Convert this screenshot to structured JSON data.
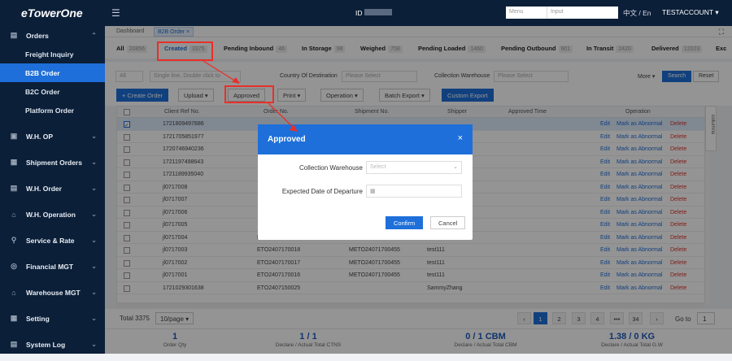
{
  "app": {
    "logo": "eTowerOne"
  },
  "topbar": {
    "id_label": "ID",
    "menu_select": "Menu",
    "menu_input": "Input",
    "lang": "中文 / En",
    "account": "TESTACCOUNT ▾"
  },
  "sidebar": {
    "items": [
      {
        "label": "Orders",
        "icon": "orders-icon",
        "glyph": "▤",
        "expanded": true,
        "children": [
          "Freight Inquiry",
          "B2B Order",
          "B2C Order",
          "Platform Order"
        ],
        "active_child": "B2B Order"
      },
      {
        "label": "W.H. OP",
        "icon": "warehouse-op-icon",
        "glyph": "▣"
      },
      {
        "label": "Shipment Orders",
        "icon": "shipment-icon",
        "glyph": "▦"
      },
      {
        "label": "W.H. Order",
        "icon": "wh-order-icon",
        "glyph": "▤"
      },
      {
        "label": "W.H. Operation",
        "icon": "wh-operation-icon",
        "glyph": "⌂"
      },
      {
        "label": "Service & Rate",
        "icon": "service-icon",
        "glyph": "⚲"
      },
      {
        "label": "Financial MGT",
        "icon": "financial-icon",
        "glyph": "◎"
      },
      {
        "label": "Warehouse MGT",
        "icon": "warehouse-mgt-icon",
        "glyph": "⌂"
      },
      {
        "label": "Setting",
        "icon": "setting-icon",
        "glyph": "▦"
      },
      {
        "label": "System Log",
        "icon": "log-icon",
        "glyph": "▤"
      }
    ]
  },
  "breadcrumb": {
    "home": "Dashboard",
    "tab": "B2B Order ×"
  },
  "status_tabs": [
    {
      "label": "All",
      "count": "20856"
    },
    {
      "label": "Created",
      "count": "3375",
      "active": true
    },
    {
      "label": "Pending Inbound",
      "count": "46"
    },
    {
      "label": "In Storage",
      "count": "98"
    },
    {
      "label": "Weighed",
      "count": "758"
    },
    {
      "label": "Pending Loaded",
      "count": "1460"
    },
    {
      "label": "Pending Outbound",
      "count": "901"
    },
    {
      "label": "In Transit",
      "count": "2420"
    },
    {
      "label": "Delivered",
      "count": "12023"
    },
    {
      "label": "Exc",
      "count": ""
    }
  ],
  "filter": {
    "all": "All",
    "search_placeholder": "Single line, Double click to",
    "dest_label": "Country Of Destination",
    "please_select": "Please Select",
    "collection_label": "Collection Warehouse",
    "more": "More ▾",
    "search_btn": "Search",
    "reset_btn": "Reset"
  },
  "toolbar": {
    "create": "+ Create Order",
    "upload": "Upload ▾",
    "approved": "Approved",
    "print": "Print ▾",
    "operation": "Operation ▾",
    "batch_export": "Batch Export ▾",
    "custom_export": "Custom Export"
  },
  "table": {
    "headers": {
      "client_ref": "Client Ref No.",
      "order_no": "Order No.",
      "shipment_no": "Shipment No.",
      "shipper": "Shipper",
      "approved_time": "Approved Time",
      "operation": "Operation"
    },
    "op": {
      "edit": "Edit",
      "mark": "Mark as Abnormal",
      "delete": "Delete"
    },
    "columns_label": "columns",
    "rows": [
      {
        "ref": "1721809497886",
        "order": "",
        "shipment": "",
        "shipper": "",
        "checked": true
      },
      {
        "ref": "1721705851977",
        "order": "",
        "shipment": "",
        "shipper": ""
      },
      {
        "ref": "1720746940236",
        "order": "",
        "shipment": "",
        "shipper": ""
      },
      {
        "ref": "1721197498643",
        "order": "",
        "shipment": "",
        "shipper": ""
      },
      {
        "ref": "1721189935040",
        "order": "",
        "shipment": "",
        "shipper": ""
      },
      {
        "ref": "jl0717008",
        "order": "",
        "shipment": "",
        "shipper": ""
      },
      {
        "ref": "jl0717007",
        "order": "",
        "shipment": "",
        "shipper": ""
      },
      {
        "ref": "jl0717006",
        "order": "",
        "shipment": "",
        "shipper": ""
      },
      {
        "ref": "jl0717005",
        "order": "",
        "shipment": "",
        "shipper": ""
      },
      {
        "ref": "jl0717004",
        "order": "ETO2407170019",
        "shipment": "METO24071700455",
        "shipper": "test111"
      },
      {
        "ref": "jl0717003",
        "order": "ETO2407170018",
        "shipment": "METO24071700455",
        "shipper": "test111"
      },
      {
        "ref": "jl0717002",
        "order": "ETO2407170017",
        "shipment": "METO24071700455",
        "shipper": "test111"
      },
      {
        "ref": "jl0717001",
        "order": "ETO2407170016",
        "shipment": "METO24071700455",
        "shipper": "test111"
      },
      {
        "ref": "1721029301638",
        "order": "ETO2407150025",
        "shipment": "",
        "shipper": "SammyZhang"
      }
    ]
  },
  "pager": {
    "total": "Total 3375",
    "page_size": "10/page ▾",
    "pages": [
      "‹",
      "1",
      "2",
      "3",
      "4",
      "•••",
      "34",
      "›"
    ],
    "active_page": "1",
    "goto": "Go to",
    "goto_value": "1"
  },
  "summary": [
    {
      "value": "1",
      "label": "Order Qty"
    },
    {
      "value": "1 / 1",
      "label": "Declare / Actual Total CTNS"
    },
    {
      "value": "0 / 1 CBM",
      "label": "Declare / Actual Total CBM"
    },
    {
      "value": "1.38 / 0 KG",
      "label": "Declare / Actual Total G.W"
    }
  ],
  "modal": {
    "title": "Approved",
    "close": "×",
    "collection_label": "Collection Warehouse",
    "collection_placeholder": "Select",
    "departure_label": "Expected Date of Departure",
    "calendar_icon": "calendar-icon",
    "confirm": "Confirm",
    "cancel": "Cancel"
  },
  "colors": {
    "primary": "#1e6fd9",
    "sidebar": "#0b1f38",
    "highlight": "#e8302a",
    "danger": "#e0342b"
  }
}
